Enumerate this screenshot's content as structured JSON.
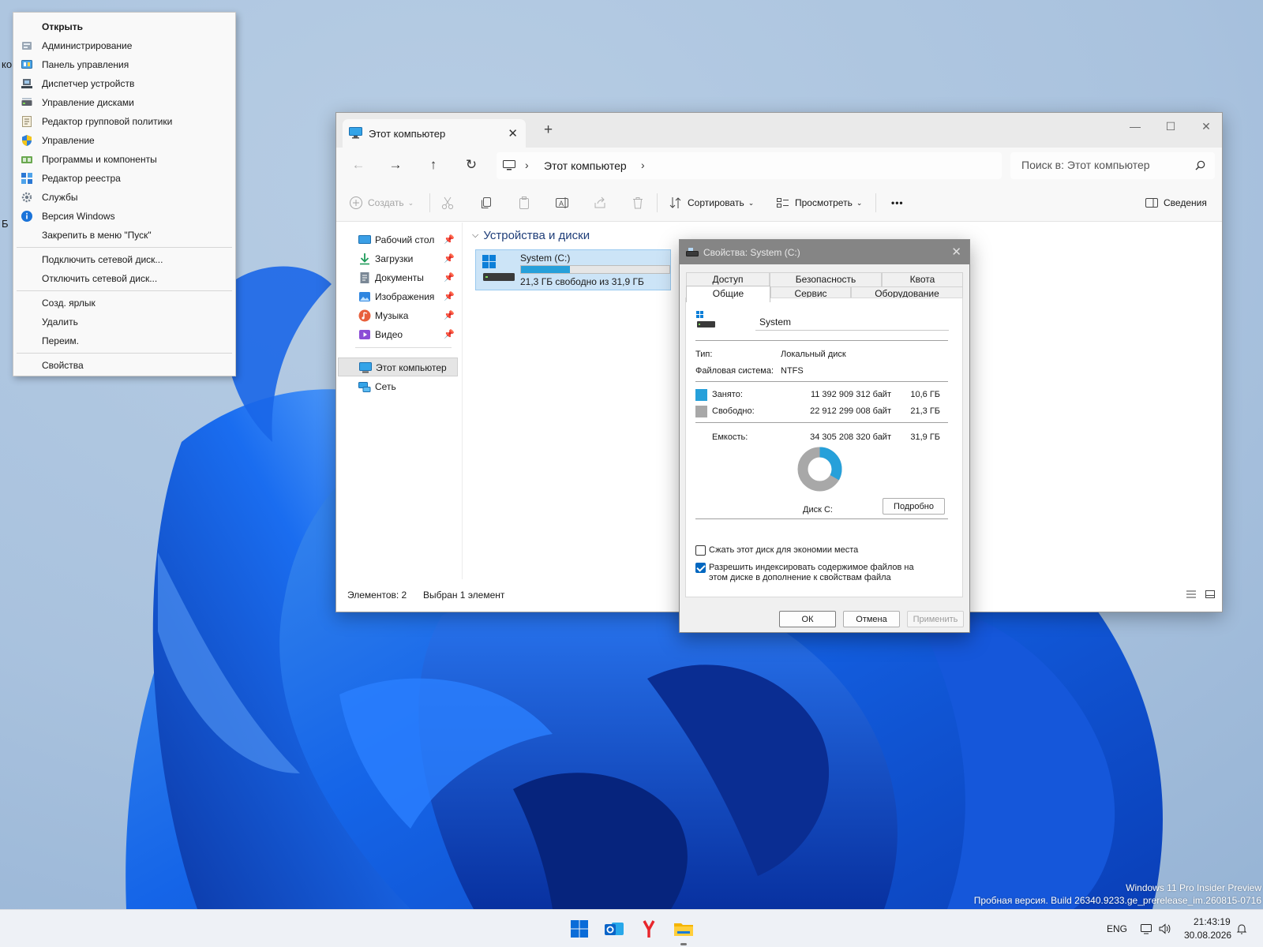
{
  "desktop": {
    "fragments": [
      "ко",
      "Б"
    ],
    "watermark": {
      "line1": "Windows 11 Pro Insider Preview",
      "line2": "Пробная версия. Build 26340.9233.ge_prerelease_im.260815-0716"
    }
  },
  "context_menu": {
    "items": [
      {
        "label": "Открыть",
        "icon": "none"
      },
      {
        "label": "Администрирование",
        "icon": "admin-tools-icon"
      },
      {
        "label": "Панель управления",
        "icon": "control-panel-icon"
      },
      {
        "label": "Диспетчер устройств",
        "icon": "device-manager-icon"
      },
      {
        "label": "Управление дисками",
        "icon": "disk-management-icon"
      },
      {
        "label": "Редактор групповой политики",
        "icon": "group-policy-icon"
      },
      {
        "label": "Управление",
        "icon": "shield-icon"
      },
      {
        "label": "Программы и компоненты",
        "icon": "programs-icon"
      },
      {
        "label": "Редактор реестра",
        "icon": "registry-icon"
      },
      {
        "label": "Службы",
        "icon": "gear-icon"
      },
      {
        "label": "Версия Windows",
        "icon": "info-icon"
      },
      {
        "label": "Закрепить в меню \"Пуск\"",
        "icon": "none"
      },
      {
        "label": "Подключить сетевой диск...",
        "icon": "none"
      },
      {
        "label": "Отключить сетевой диск...",
        "icon": "none"
      },
      {
        "label": "Созд. ярлык",
        "icon": "none"
      },
      {
        "label": "Удалить",
        "icon": "none"
      },
      {
        "label": "Переим.",
        "icon": "none"
      },
      {
        "label": "Свойства",
        "icon": "none"
      }
    ]
  },
  "explorer": {
    "tab_title": "Этот компьютер",
    "tab_close": "✕",
    "new_tab": "+",
    "window_controls": {
      "minimize": "—",
      "maximize": "☐",
      "close": "✕"
    },
    "nav_buttons": {
      "back": "←",
      "forward": "→",
      "up": "↑",
      "refresh": "↻"
    },
    "address": {
      "location": "Этот компьютер",
      "separator": "›"
    },
    "search_placeholder": "Поиск в: Этот компьютер",
    "commands": {
      "create": "Создать",
      "sort": "Сортировать",
      "view": "Просмотреть",
      "more": "•••",
      "details": "Сведения",
      "dropdown": "⌄"
    },
    "sidebar": {
      "pinned": [
        {
          "label": "Рабочий стол",
          "icon": "desktop-icon"
        },
        {
          "label": "Загрузки",
          "icon": "downloads-icon"
        },
        {
          "label": "Документы",
          "icon": "documents-icon"
        },
        {
          "label": "Изображения",
          "icon": "pictures-icon"
        },
        {
          "label": "Музыка",
          "icon": "music-icon"
        },
        {
          "label": "Видео",
          "icon": "videos-icon"
        }
      ],
      "pin_glyph": "📌",
      "this_pc": "Этот компьютер",
      "network": "Сеть"
    },
    "group_header": "Устройства и диски",
    "group_chevron": "⌵",
    "drive": {
      "name": "System (C:)",
      "free_text": "21,3 ГБ свободно из 31,9 ГБ",
      "used_fraction": 0.332
    },
    "status": {
      "items_count": "Элементов: 2",
      "selected": "Выбран 1 элемент"
    }
  },
  "properties": {
    "title": "Свойства: System (C:)",
    "close": "✕",
    "tabs_row1": [
      "Доступ",
      "Безопасность",
      "Квота"
    ],
    "tabs_row2": [
      "Общие",
      "Сервис",
      "Оборудование"
    ],
    "active_tab": "Общие",
    "volume_label": "System",
    "type_label": "Тип:",
    "type_value": "Локальный диск",
    "fs_label": "Файловая система:",
    "fs_value": "NTFS",
    "used_label": "Занято:",
    "used_bytes": "11 392 909 312 байт",
    "used_size": "10,6 ГБ",
    "free_label": "Свободно:",
    "free_bytes": "22 912 299 008 байт",
    "free_size": "21,3 ГБ",
    "capacity_label": "Емкость:",
    "capacity_bytes": "34 305 208 320 байт",
    "capacity_size": "31,9 ГБ",
    "disk_label": "Диск C:",
    "details_button": "Подробно",
    "used_fraction": 0.332,
    "colors": {
      "used": "#26a0da",
      "free": "#a8a8a8"
    },
    "compress_label": "Сжать этот диск для экономии места",
    "compress_checked": false,
    "index_label_line1": "Разрешить индексировать содержимое файлов на",
    "index_label_line2": "этом диске в дополнение к свойствам файла",
    "index_checked": true,
    "ok": "ОК",
    "cancel": "Отмена",
    "apply": "Применить"
  },
  "taskbar": {
    "apps": [
      "windows-start-icon",
      "outlook-icon",
      "yandex-browser-icon",
      "file-explorer-icon"
    ],
    "language": "ENG",
    "time": "21:43:19",
    "date": "30.08.2026"
  }
}
